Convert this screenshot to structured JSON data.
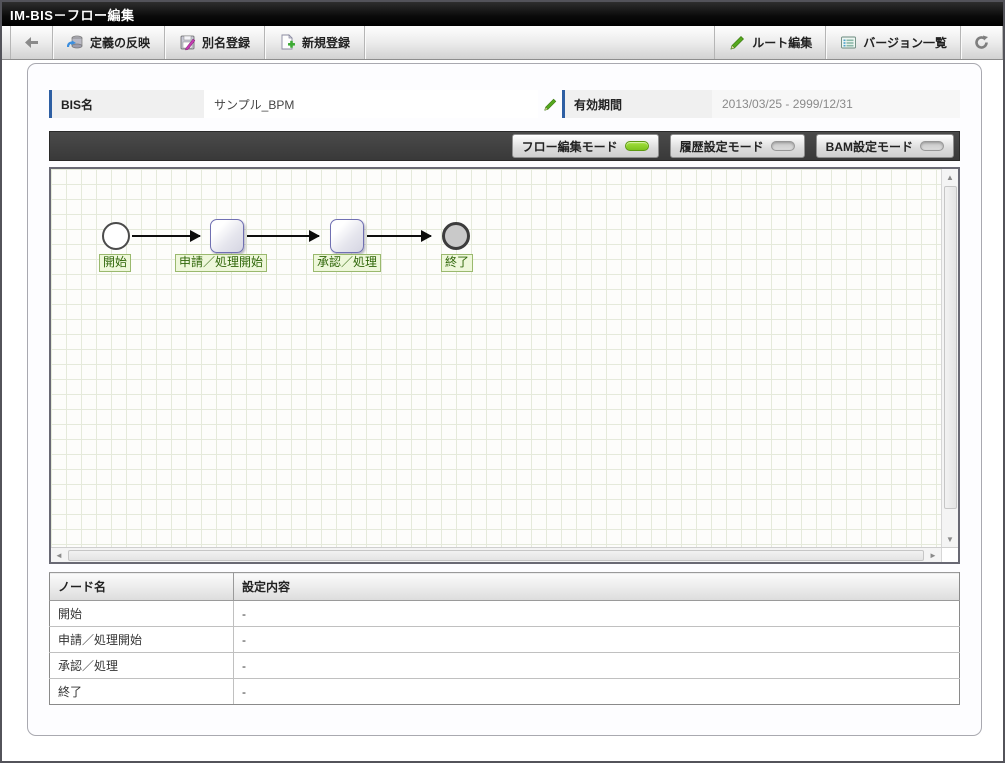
{
  "window": {
    "title": "IM-BIS－フロー編集"
  },
  "toolbar": {
    "reflect_definition": "定義の反映",
    "alias_register": "別名登録",
    "new_register": "新規登録",
    "route_edit": "ルート編集",
    "version_list": "バージョン一覧"
  },
  "fields": {
    "bis_name_label": "BIS名",
    "bis_name_value": "サンプル_BPM",
    "valid_period_label": "有効期間",
    "valid_period_value": "2013/03/25 - 2999/12/31"
  },
  "modes": {
    "active": "flow_edit",
    "flow_edit": "フロー編集モード",
    "history_setting": "履歴設定モード",
    "bam_setting": "BAM設定モード"
  },
  "flow": {
    "nodes": [
      {
        "type": "start",
        "label": "開始"
      },
      {
        "type": "task",
        "label": "申請／処理開始"
      },
      {
        "type": "task",
        "label": "承認／処理"
      },
      {
        "type": "end",
        "label": "終了"
      }
    ]
  },
  "table": {
    "headers": [
      "ノード名",
      "設定内容"
    ],
    "rows": [
      {
        "name": "開始",
        "value": "-"
      },
      {
        "name": "申請／処理開始",
        "value": "-"
      },
      {
        "name": "承認／処理",
        "value": "-"
      },
      {
        "name": "終了",
        "value": "-"
      }
    ]
  },
  "colors": {
    "accent_blue": "#2e5fa3",
    "mode_active_green": "#7cc31e",
    "node_label_bg": "#eef7da",
    "node_label_border": "#9ab96e",
    "node_label_text": "#2f6609",
    "titlebar_bg": "#000000"
  }
}
